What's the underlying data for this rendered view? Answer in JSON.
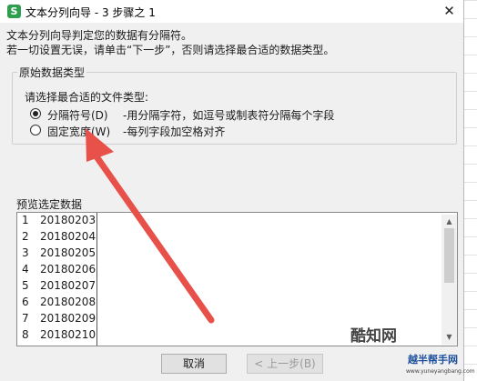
{
  "window": {
    "title": "文本分列向导 - 3 步骤之 1",
    "app_icon_letter": "S",
    "close_glyph": "✕"
  },
  "intro": {
    "line1": "文本分列向导判定您的数据有分隔符。",
    "line2": "若一切设置无误，请单击“下一步”，否则请选择最合适的数据类型。"
  },
  "original_type": {
    "legend": "原始数据类型",
    "prompt": "请选择最合适的文件类型:",
    "options": [
      {
        "label": "分隔符号(D)",
        "description": "-用分隔字符，如逗号或制表符分隔每个字段",
        "checked": true
      },
      {
        "label": "固定宽度(W)",
        "description": "-每列字段加空格对齐",
        "checked": false
      }
    ]
  },
  "preview": {
    "legend": "预览选定数据",
    "rows": [
      {
        "num": "1",
        "value": "20180203"
      },
      {
        "num": "2",
        "value": "20180204"
      },
      {
        "num": "3",
        "value": "20180205"
      },
      {
        "num": "4",
        "value": "20180206"
      },
      {
        "num": "5",
        "value": "20180207"
      },
      {
        "num": "6",
        "value": "20180208"
      },
      {
        "num": "7",
        "value": "20180209"
      },
      {
        "num": "8",
        "value": "20180210"
      }
    ]
  },
  "buttons": {
    "cancel": "取消",
    "back": "< 上一步(B)"
  },
  "annotation": {
    "arrow_color": "#e8504a"
  },
  "watermark": {
    "logo_text": "酷知网",
    "site": "www.yuneyangbang.com",
    "tagline": "越半帮手网"
  }
}
